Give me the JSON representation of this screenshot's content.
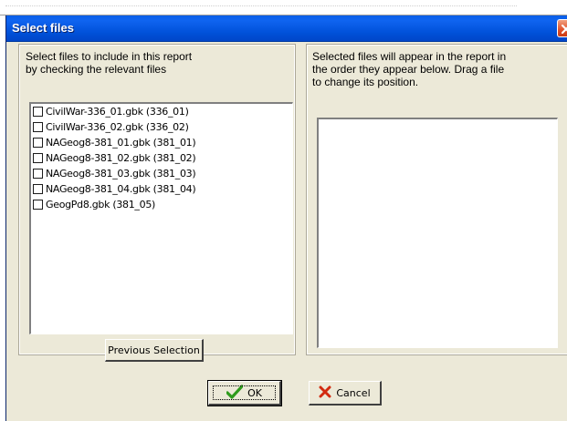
{
  "dialog": {
    "title": "Select files"
  },
  "left_panel": {
    "instructions": "Select files to  include in this report\nby checking the relevant files",
    "files": [
      {
        "label": "CivilWar-336_01.gbk (336_01)",
        "checked": false
      },
      {
        "label": "CivilWar-336_02.gbk (336_02)",
        "checked": false
      },
      {
        "label": "NAGeog8-381_01.gbk (381_01)",
        "checked": false
      },
      {
        "label": "NAGeog8-381_02.gbk (381_02)",
        "checked": false
      },
      {
        "label": "NAGeog8-381_03.gbk (381_03)",
        "checked": false
      },
      {
        "label": "NAGeog8-381_04.gbk (381_04)",
        "checked": false
      },
      {
        "label": "GeogPd8.gbk (381_05)",
        "checked": false
      }
    ],
    "previous_selection_label": "Previous Selection"
  },
  "right_panel": {
    "instructions": "Selected files will appear in the report in\nthe order they appear below.  Drag a file\nto change its position."
  },
  "buttons": {
    "ok_label": "OK",
    "cancel_label": "Cancel"
  },
  "icons": {
    "ok": "checkmark-icon",
    "cancel": "x-cross-icon",
    "close": "close-icon"
  },
  "colors": {
    "titlebar": "#0054e3",
    "dialog_face": "#ece9d8",
    "close_button": "#e0502a",
    "ok_check": "#2e9a1c",
    "cancel_x": "#d22a10"
  }
}
